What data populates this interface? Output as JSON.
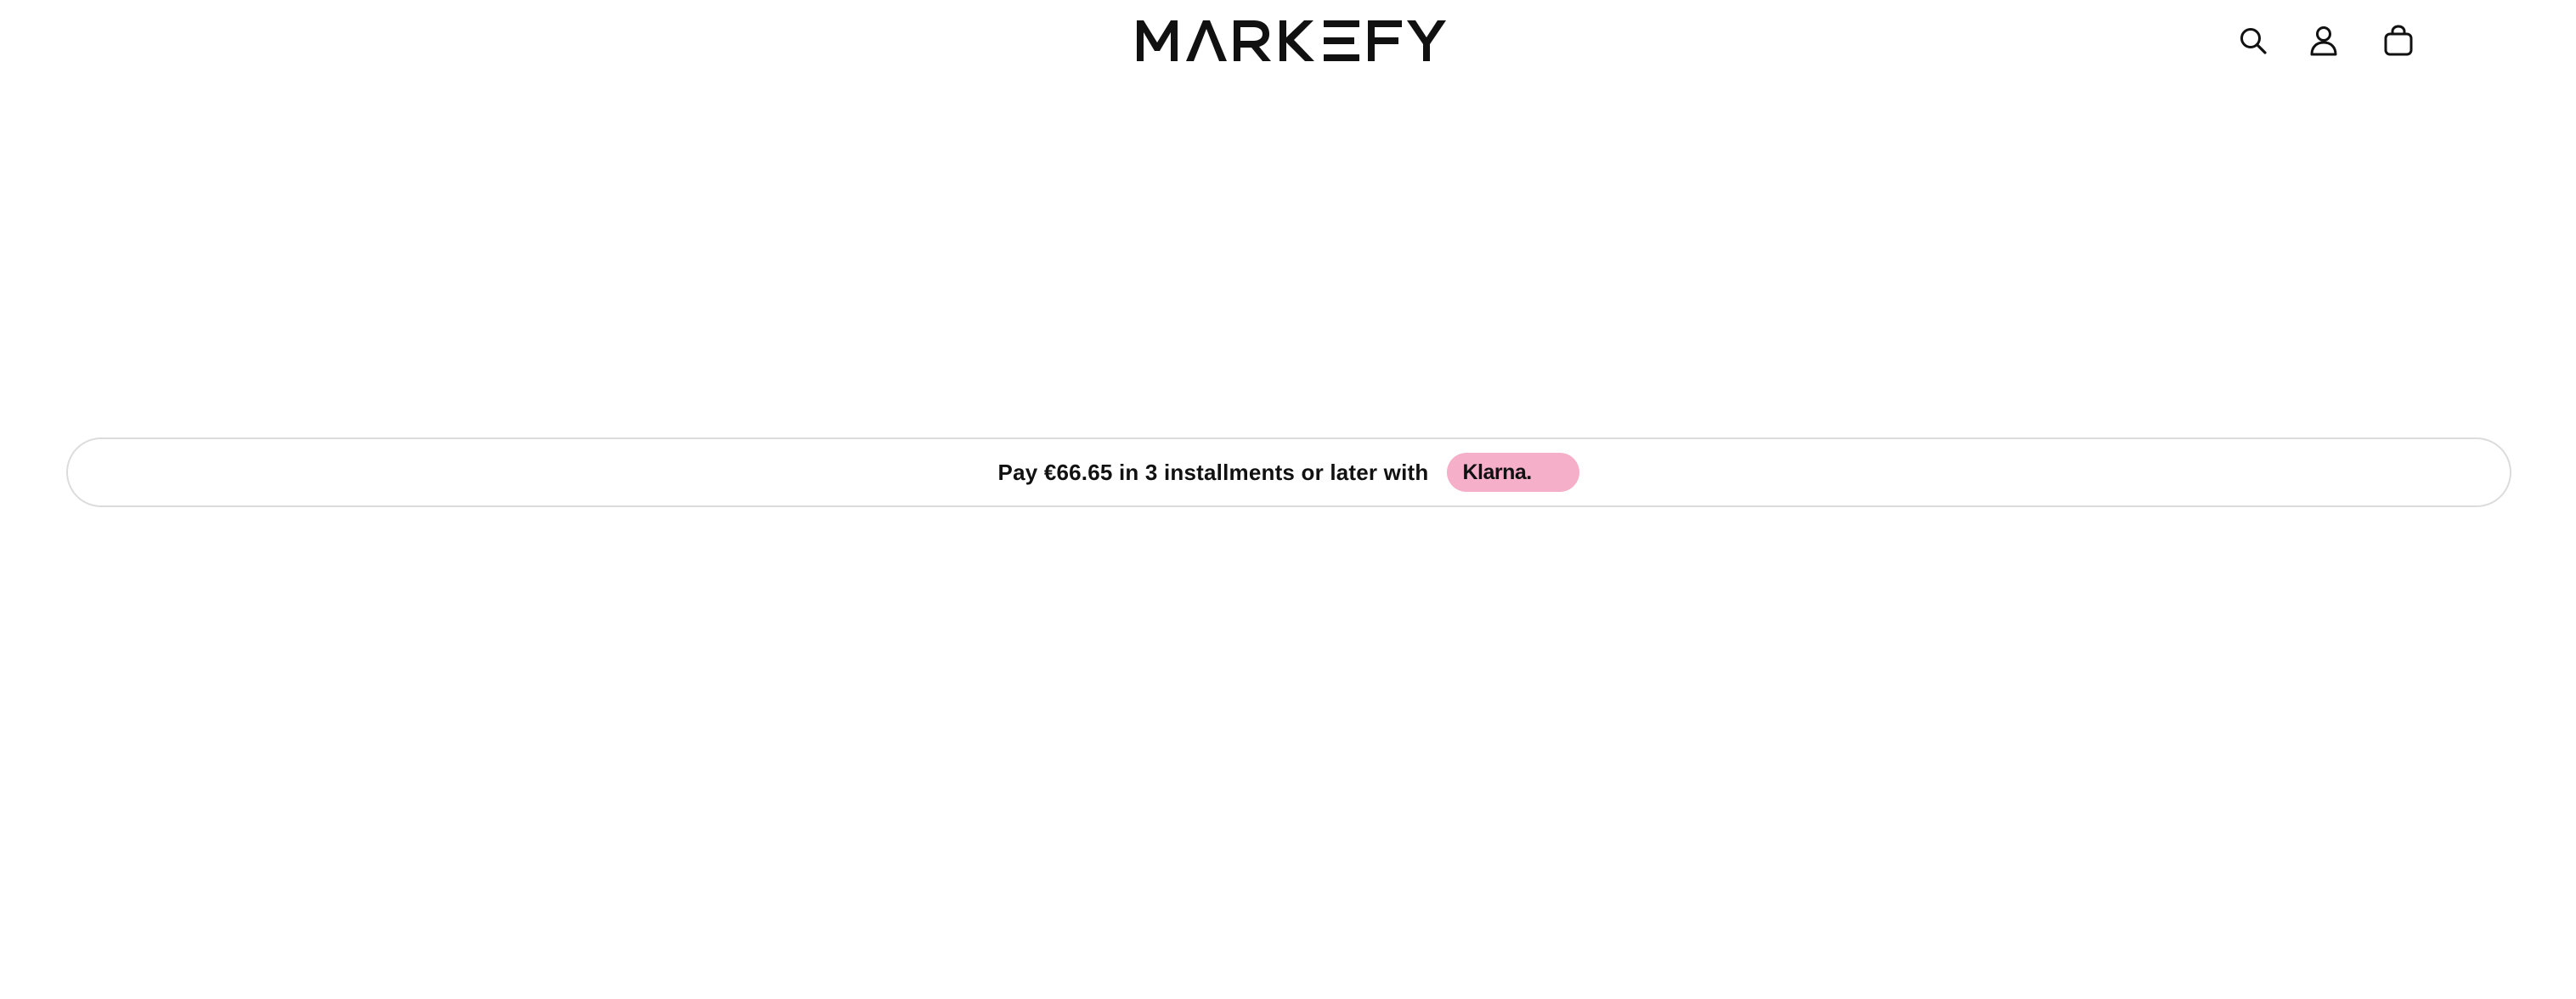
{
  "header": {
    "logo_text": "MARKEFY",
    "icons": {
      "search": "search-icon",
      "account": "user-icon",
      "cart": "shopping-bag-icon"
    }
  },
  "klarna": {
    "message": "Pay €66.65 in 3 installments or later with",
    "brand": "Klarna.",
    "badge_color": "#f5afc8"
  }
}
